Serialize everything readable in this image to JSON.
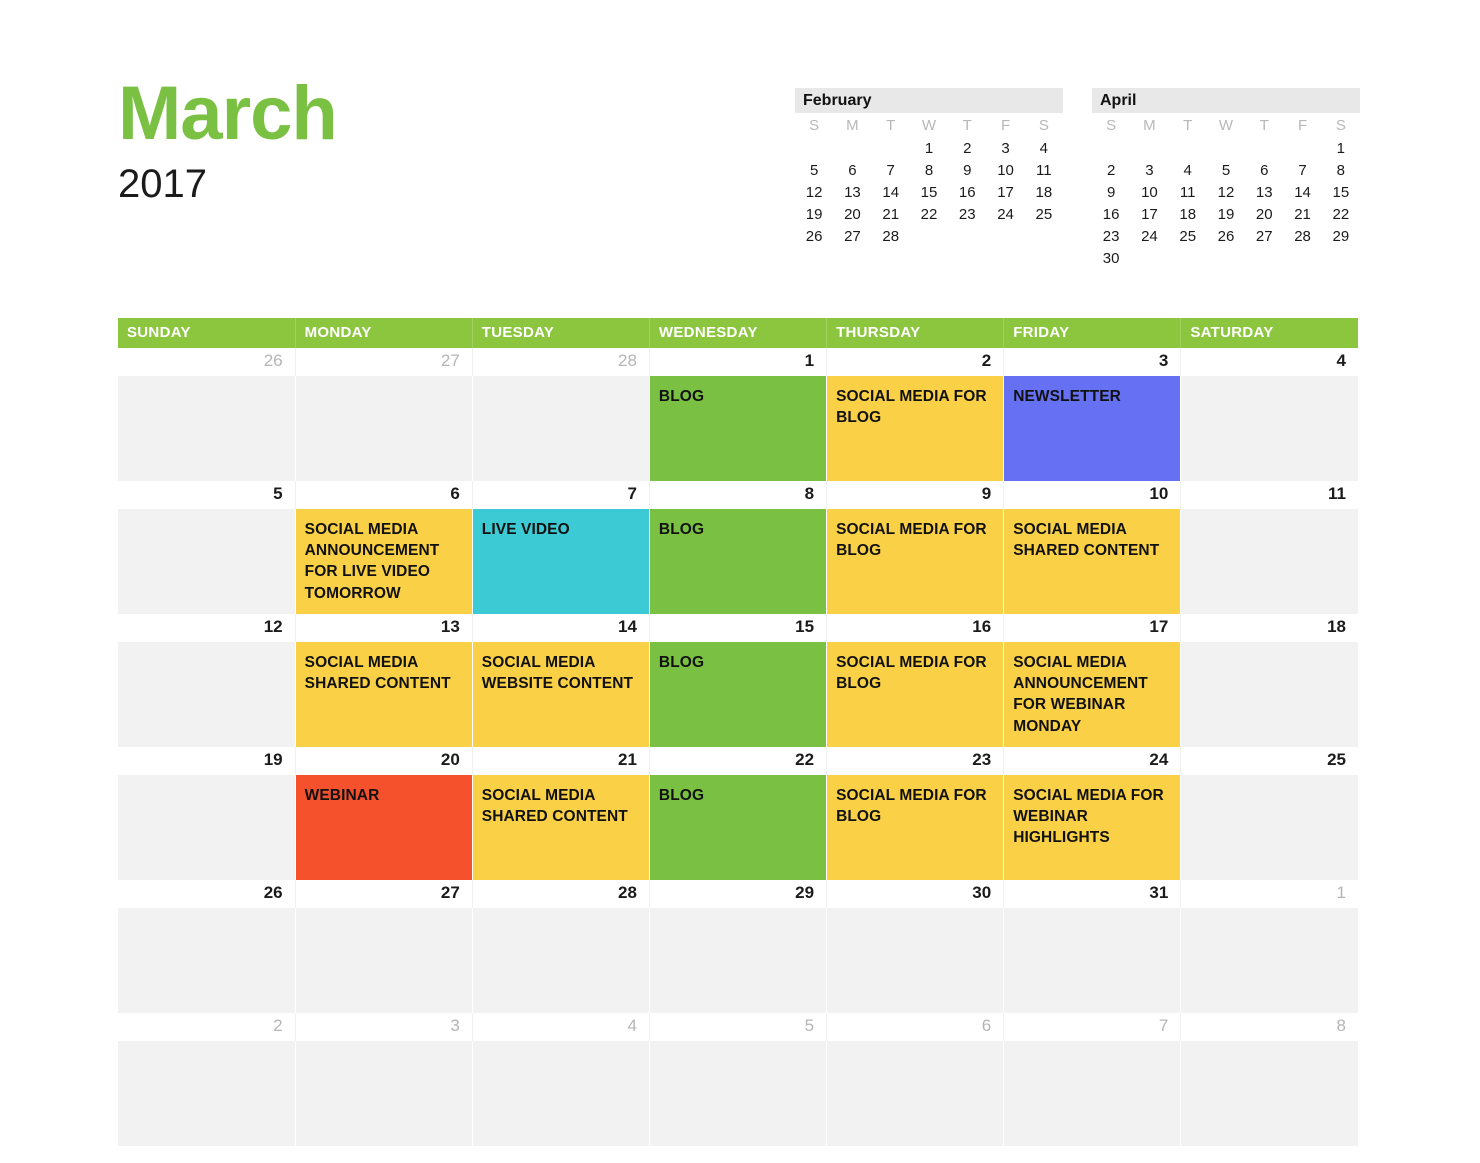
{
  "header": {
    "month": "March",
    "year": "2017"
  },
  "mini_calendars": [
    {
      "name": "prev-month",
      "title": "February",
      "dow": [
        "S",
        "M",
        "T",
        "W",
        "T",
        "F",
        "S"
      ],
      "weeks": [
        [
          "",
          "",
          "",
          "1",
          "2",
          "3",
          "4"
        ],
        [
          "5",
          "6",
          "7",
          "8",
          "9",
          "10",
          "11"
        ],
        [
          "12",
          "13",
          "14",
          "15",
          "16",
          "17",
          "18"
        ],
        [
          "19",
          "20",
          "21",
          "22",
          "23",
          "24",
          "25"
        ],
        [
          "26",
          "27",
          "28",
          "",
          "",
          "",
          ""
        ]
      ]
    },
    {
      "name": "next-month",
      "title": "April",
      "dow": [
        "S",
        "M",
        "T",
        "W",
        "T",
        "F",
        "S"
      ],
      "weeks": [
        [
          "",
          "",
          "",
          "",
          "",
          "",
          "1"
        ],
        [
          "2",
          "3",
          "4",
          "5",
          "6",
          "7",
          "8"
        ],
        [
          "9",
          "10",
          "11",
          "12",
          "13",
          "14",
          "15"
        ],
        [
          "16",
          "17",
          "18",
          "19",
          "20",
          "21",
          "22"
        ],
        [
          "23",
          "24",
          "25",
          "26",
          "27",
          "28",
          "29"
        ],
        [
          "30",
          "",
          "",
          "",
          "",
          "",
          ""
        ]
      ]
    }
  ],
  "calendar": {
    "day_headers": [
      "SUNDAY",
      "MONDAY",
      "TUESDAY",
      "WEDNESDAY",
      "THURSDAY",
      "FRIDAY",
      "SATURDAY"
    ],
    "colors": {
      "header_green": "#8cc63f",
      "blog_green": "#7ac143",
      "social_yellow": "#fad146",
      "newsletter_blue": "#6571f2",
      "live_video_cyan": "#3ccbd4",
      "webinar_red": "#f4512c",
      "empty_cell_gray": "#f2f2f2",
      "date_cell_white": "#ffffff",
      "other_month_text": "#b5b5b5"
    },
    "weeks": [
      {
        "dates": [
          {
            "num": "26",
            "other_month": true
          },
          {
            "num": "27",
            "other_month": true
          },
          {
            "num": "28",
            "other_month": true
          },
          {
            "num": "1",
            "other_month": false
          },
          {
            "num": "2",
            "other_month": false
          },
          {
            "num": "3",
            "other_month": false
          },
          {
            "num": "4",
            "other_month": false
          }
        ],
        "events": [
          {
            "label": "",
            "color": ""
          },
          {
            "label": "",
            "color": ""
          },
          {
            "label": "",
            "color": ""
          },
          {
            "label": "BLOG",
            "color": "#7ac143"
          },
          {
            "label": "SOCIAL MEDIA FOR BLOG",
            "color": "#fad146"
          },
          {
            "label": "NEWSLETTER",
            "color": "#6571f2"
          },
          {
            "label": "",
            "color": ""
          }
        ]
      },
      {
        "dates": [
          {
            "num": "5",
            "other_month": false
          },
          {
            "num": "6",
            "other_month": false
          },
          {
            "num": "7",
            "other_month": false
          },
          {
            "num": "8",
            "other_month": false
          },
          {
            "num": "9",
            "other_month": false
          },
          {
            "num": "10",
            "other_month": false
          },
          {
            "num": "11",
            "other_month": false
          }
        ],
        "events": [
          {
            "label": "",
            "color": ""
          },
          {
            "label": "SOCIAL MEDIA ANNOUNCEMENT FOR LIVE VIDEO TOMORROW",
            "color": "#fad146"
          },
          {
            "label": "LIVE VIDEO",
            "color": "#3ccbd4"
          },
          {
            "label": "BLOG",
            "color": "#7ac143"
          },
          {
            "label": "SOCIAL MEDIA FOR BLOG",
            "color": "#fad146"
          },
          {
            "label": "SOCIAL MEDIA SHARED CONTENT",
            "color": "#fad146"
          },
          {
            "label": "",
            "color": ""
          }
        ]
      },
      {
        "dates": [
          {
            "num": "12",
            "other_month": false
          },
          {
            "num": "13",
            "other_month": false
          },
          {
            "num": "14",
            "other_month": false
          },
          {
            "num": "15",
            "other_month": false
          },
          {
            "num": "16",
            "other_month": false
          },
          {
            "num": "17",
            "other_month": false
          },
          {
            "num": "18",
            "other_month": false
          }
        ],
        "events": [
          {
            "label": "",
            "color": ""
          },
          {
            "label": "SOCIAL MEDIA SHARED CONTENT",
            "color": "#fad146"
          },
          {
            "label": "SOCIAL MEDIA WEBSITE CONTENT",
            "color": "#fad146"
          },
          {
            "label": "BLOG",
            "color": "#7ac143"
          },
          {
            "label": "SOCIAL MEDIA FOR BLOG",
            "color": "#fad146"
          },
          {
            "label": "SOCIAL MEDIA ANNOUNCEMENT FOR WEBINAR MONDAY",
            "color": "#fad146"
          },
          {
            "label": "",
            "color": ""
          }
        ]
      },
      {
        "dates": [
          {
            "num": "19",
            "other_month": false
          },
          {
            "num": "20",
            "other_month": false
          },
          {
            "num": "21",
            "other_month": false
          },
          {
            "num": "22",
            "other_month": false
          },
          {
            "num": "23",
            "other_month": false
          },
          {
            "num": "24",
            "other_month": false
          },
          {
            "num": "25",
            "other_month": false
          }
        ],
        "events": [
          {
            "label": "",
            "color": ""
          },
          {
            "label": "WEBINAR",
            "color": "#f4512c"
          },
          {
            "label": "SOCIAL MEDIA SHARED CONTENT",
            "color": "#fad146"
          },
          {
            "label": "BLOG",
            "color": "#7ac143"
          },
          {
            "label": "SOCIAL MEDIA FOR BLOG",
            "color": "#fad146"
          },
          {
            "label": "SOCIAL MEDIA FOR WEBINAR HIGHLIGHTS",
            "color": "#fad146"
          },
          {
            "label": "",
            "color": ""
          }
        ]
      },
      {
        "dates": [
          {
            "num": "26",
            "other_month": false
          },
          {
            "num": "27",
            "other_month": false
          },
          {
            "num": "28",
            "other_month": false
          },
          {
            "num": "29",
            "other_month": false
          },
          {
            "num": "30",
            "other_month": false
          },
          {
            "num": "31",
            "other_month": false
          },
          {
            "num": "1",
            "other_month": true
          }
        ],
        "events": [
          {
            "label": "",
            "color": ""
          },
          {
            "label": "",
            "color": ""
          },
          {
            "label": "",
            "color": ""
          },
          {
            "label": "",
            "color": ""
          },
          {
            "label": "",
            "color": ""
          },
          {
            "label": "",
            "color": ""
          },
          {
            "label": "",
            "color": ""
          }
        ]
      },
      {
        "dates": [
          {
            "num": "2",
            "other_month": true
          },
          {
            "num": "3",
            "other_month": true
          },
          {
            "num": "4",
            "other_month": true
          },
          {
            "num": "5",
            "other_month": true
          },
          {
            "num": "6",
            "other_month": true
          },
          {
            "num": "7",
            "other_month": true
          },
          {
            "num": "8",
            "other_month": true
          }
        ],
        "events": [
          {
            "label": "",
            "color": ""
          },
          {
            "label": "",
            "color": ""
          },
          {
            "label": "",
            "color": ""
          },
          {
            "label": "",
            "color": ""
          },
          {
            "label": "",
            "color": ""
          },
          {
            "label": "",
            "color": ""
          },
          {
            "label": "",
            "color": ""
          }
        ]
      }
    ]
  }
}
